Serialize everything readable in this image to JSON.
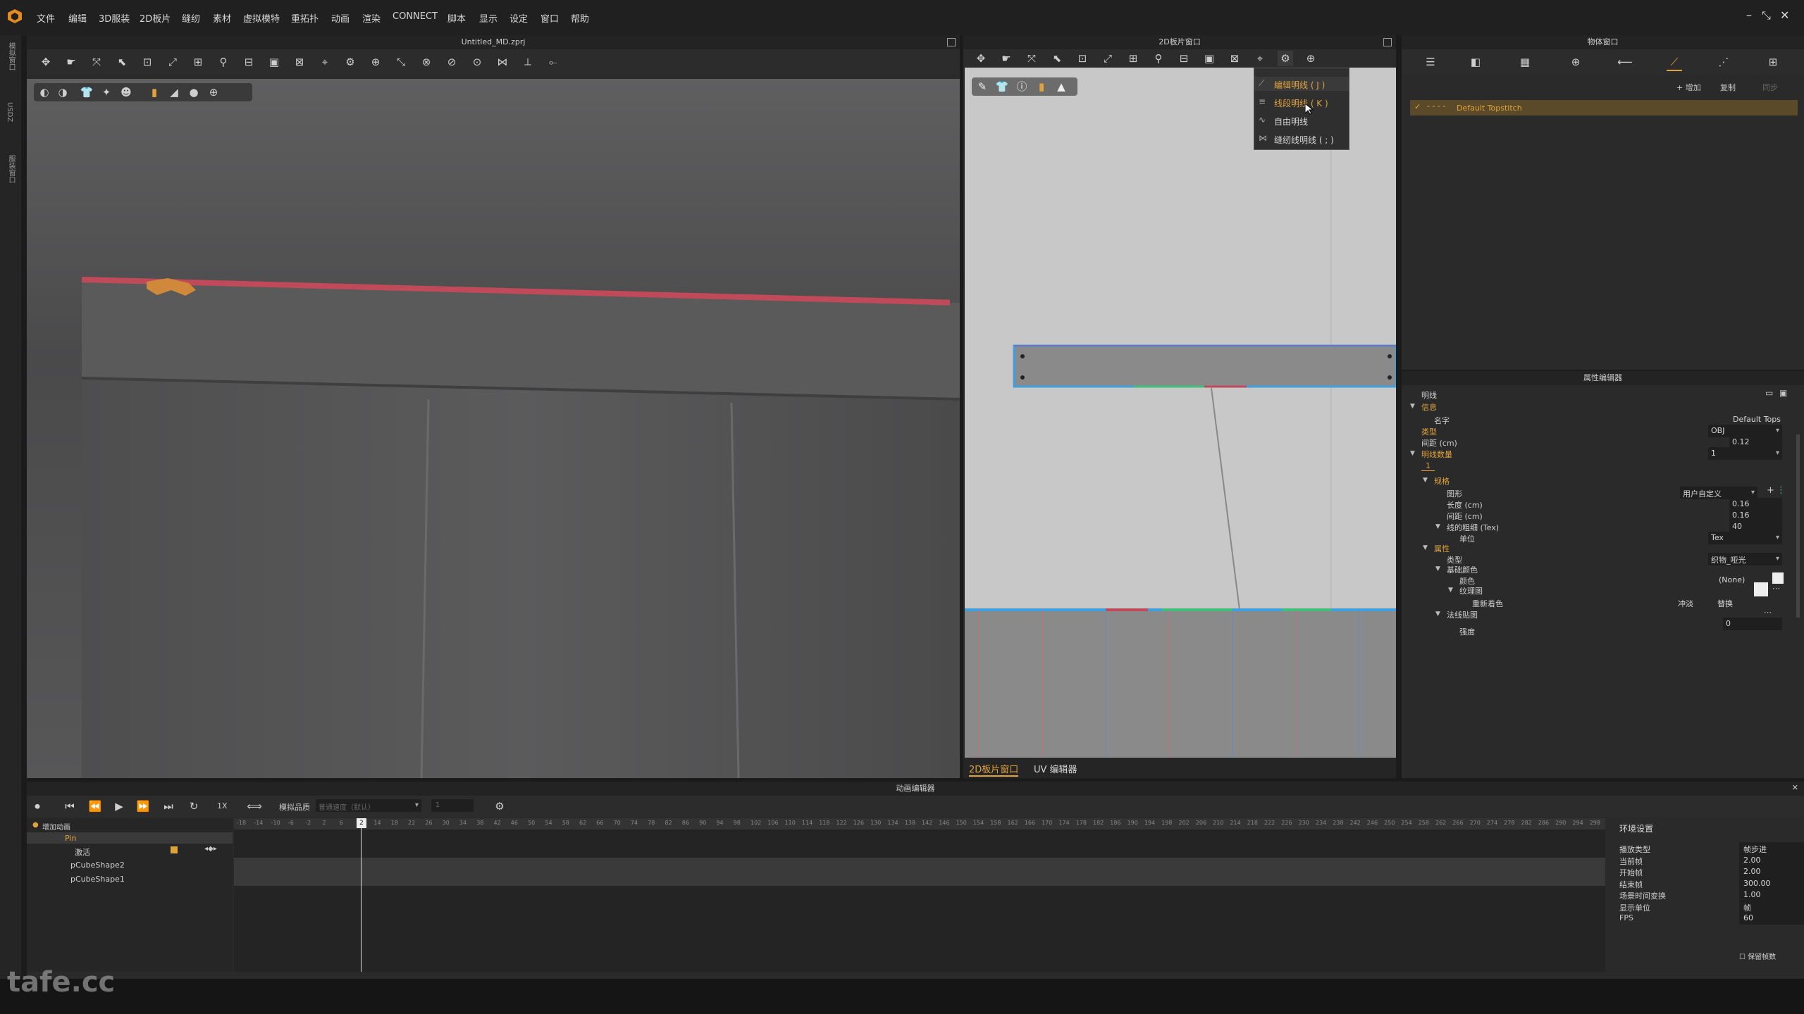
{
  "menubar": {
    "items": [
      "文件",
      "编辑",
      "3D服装",
      "2D板片",
      "缝纫",
      "素材",
      "虚拟模特",
      "重拓扑",
      "动画",
      "渲染",
      "CONNECT",
      "脚本",
      "显示",
      "设定",
      "窗口",
      "帮助"
    ],
    "window_controls": [
      "–",
      "⤡",
      "✕"
    ]
  },
  "left_strip": {
    "tabs": [
      "模拟窗口",
      "USDZ",
      "服装窗口"
    ]
  },
  "view3d": {
    "title": "Untitled_MD.zprj"
  },
  "view2d": {
    "title": "2D板片窗口",
    "bottom_tabs": [
      "2D板片窗口",
      "UV 编辑器"
    ],
    "dropdown": [
      {
        "label": "编辑明线 ( J )",
        "active": true
      },
      {
        "label": "线段明线 ( K )",
        "active": true
      },
      {
        "label": "自由明线",
        "active": false
      },
      {
        "label": "缝纫线明线 ( ; )",
        "active": false
      }
    ]
  },
  "objwin": {
    "title": "物体窗口",
    "actions": [
      "+ 增加",
      "复制",
      "同步"
    ],
    "list": [
      {
        "label": "Default Topstitch",
        "checked": true
      }
    ]
  },
  "propwin": {
    "title": "属性编辑器",
    "header": "明线",
    "info_section": "信息",
    "name_label": "名字",
    "name_value": "Default Tops",
    "type_label": "类型",
    "type_value": "OBJ",
    "spacing_label": "间距 (cm)",
    "spacing_value": "0.12",
    "count_label": "明线数量",
    "count_value": "1",
    "tab_1": "1",
    "spec_section": "规格",
    "shape_label": "图形",
    "shape_value": "用户自定义",
    "length_label": "长度 (cm)",
    "length_value": "0.16",
    "gap_label": "间距 (cm)",
    "gap_value": "0.16",
    "thickness_label": "线的粗细 (Tex)",
    "thickness_value": "40",
    "unit_label": "单位",
    "unit_value": "Tex",
    "attr_section": "属性",
    "attr_type_label": "类型",
    "attr_type_value": "织物_哑光",
    "base_color_label": "基础颜色",
    "color_label": "颜色",
    "color_value": "(None)",
    "texture_label": "纹理图",
    "recolor_label": "重新着色",
    "recolor_opt1": "冲淡",
    "recolor_opt2": "替换",
    "normal_label": "法线贴图",
    "strength_label": "强度",
    "strength_value": "0"
  },
  "animwin": {
    "title": "动画编辑器",
    "quality_label": "模拟品质",
    "quality_value": "普通速度（默认）",
    "speed_value": "1X",
    "frame_value": "1",
    "add_anim": "增加动画",
    "current_frame": "2",
    "tree": [
      {
        "label": "Pin",
        "highlight": true
      },
      {
        "label": "激活",
        "highlight": false
      },
      {
        "label": "pCubeShape2",
        "highlight": false
      },
      {
        "label": "pCubeShape1",
        "highlight": false
      }
    ],
    "ruler_labels": [
      "-18",
      "-14",
      "-10",
      "-6",
      "-2",
      "2",
      "6",
      "10",
      "14",
      "18",
      "22",
      "26",
      "30",
      "34",
      "38",
      "42",
      "46",
      "50",
      "54",
      "58",
      "62",
      "66",
      "70",
      "74",
      "78",
      "82",
      "86",
      "90",
      "94",
      "98",
      "102",
      "106",
      "110",
      "114",
      "118",
      "122",
      "126",
      "130",
      "134",
      "138",
      "142",
      "146",
      "150",
      "154",
      "158",
      "162",
      "166",
      "170",
      "174",
      "178",
      "182",
      "186",
      "190",
      "194",
      "198",
      "202",
      "206",
      "210",
      "214",
      "218",
      "222",
      "226",
      "230",
      "234",
      "238",
      "242",
      "246",
      "250",
      "254",
      "258",
      "262",
      "266",
      "270",
      "274",
      "278",
      "282",
      "286",
      "290",
      "294",
      "298"
    ],
    "env": {
      "title": "环境设置",
      "rows": [
        {
          "label": "播放类型",
          "value": "帧步进"
        },
        {
          "label": "当前帧",
          "value": "2.00"
        },
        {
          "label": "开始帧",
          "value": "2.00"
        },
        {
          "label": "结束帧",
          "value": "300.00"
        },
        {
          "label": "场景时间变换",
          "value": "1.00"
        },
        {
          "label": "显示单位",
          "value": "帧"
        },
        {
          "label": "FPS",
          "value": "60"
        }
      ],
      "keep_frames": "保留帧数"
    }
  },
  "watermark": "tafe.cc"
}
